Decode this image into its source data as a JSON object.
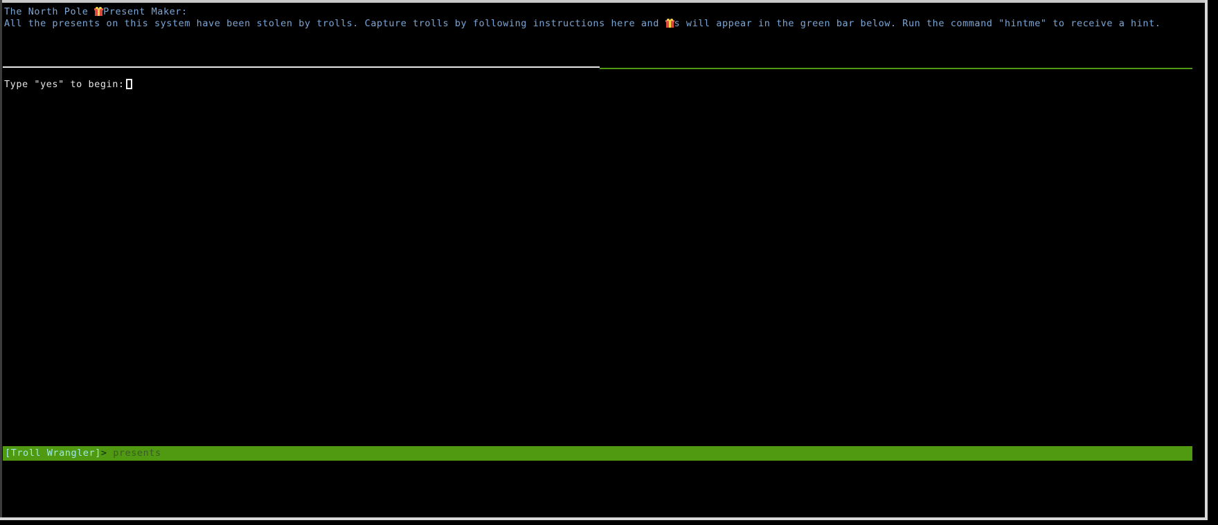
{
  "window": {
    "title": "The North Pole Present Maker Terminal",
    "background_color": "#000000",
    "border_color": "#d8d8d8"
  },
  "banner": {
    "line1_pre": "The North Pole ",
    "line1_icon": "gift-icon",
    "line1_post": "Present Maker:",
    "line2_pre": "All the presents on this system have been stolen by trolls. Capture trolls by following instructions here and ",
    "line2_icon": "gift-icon",
    "line2_post": "s will appear in the green bar below. Run the command \"hintme\" to receive a hint.",
    "text_color": "#7ba7d7"
  },
  "separator": {
    "left_rule_color": "#e8e8e8",
    "right_rule_color": "#4f9a10"
  },
  "prompt": {
    "text": "Type \"yes\" to begin:",
    "input_value": "",
    "text_color": "#e6e6e6",
    "cursor_color": "#f0f0f0"
  },
  "status_bar": {
    "agent_label": "[Troll Wrangler]",
    "arrow": ">",
    "command": "presents",
    "background_color": "#4f9a10",
    "agent_color": "#9fe8e8",
    "arrow_color": "#0c2a0c",
    "command_color": "#3a5a26"
  }
}
